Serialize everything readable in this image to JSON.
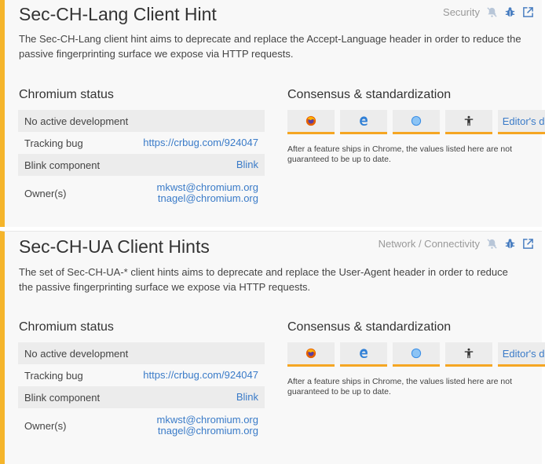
{
  "features": [
    {
      "title": "Sec-CH-Lang Client Hint",
      "category": "Security",
      "description": "The Sec-CH-Lang client hint aims to deprecate and replace the Accept-Language header in order to reduce the passive fingerprinting surface we expose via HTTP requests.",
      "status_title": "Chromium status",
      "status_text": "No active development",
      "tracking_label": "Tracking bug",
      "tracking_link": "https://crbug.com/924047",
      "component_label": "Blink component",
      "component_value": "Blink",
      "owners_label": "Owner(s)",
      "owner1": "mkwst@chromium.org",
      "owner2": "tnagel@chromium.org",
      "consensus_title": "Consensus & standardization",
      "editors_draft": "Editor's draft",
      "note": "After a feature ships in Chrome, the values listed here are not guaranteed to be up to date."
    },
    {
      "title": "Sec-CH-UA Client Hints",
      "category": "Network / Connectivity",
      "description": "The set of Sec-CH-UA-* client hints aims to deprecate and replace the User-Agent header in order to reduce the passive fingerprinting surface we expose via HTTP requests.",
      "status_title": "Chromium status",
      "status_text": "No active development",
      "tracking_label": "Tracking bug",
      "tracking_link": "https://crbug.com/924047",
      "component_label": "Blink component",
      "component_value": "Blink",
      "owners_label": "Owner(s)",
      "owner1": "mkwst@chromium.org",
      "owner2": "tnagel@chromium.org",
      "consensus_title": "Consensus & standardization",
      "editors_draft": "Editor's draft",
      "note": "After a feature ships in Chrome, the values listed here are not guaranteed to be up to date."
    }
  ],
  "colors": {
    "accent": "#f5b52b",
    "link": "#3a7bc8",
    "icon": "#4a7fc1",
    "firefox": "#e66000",
    "edge": "#2f7fd6",
    "safari": "#3a8ee6"
  }
}
